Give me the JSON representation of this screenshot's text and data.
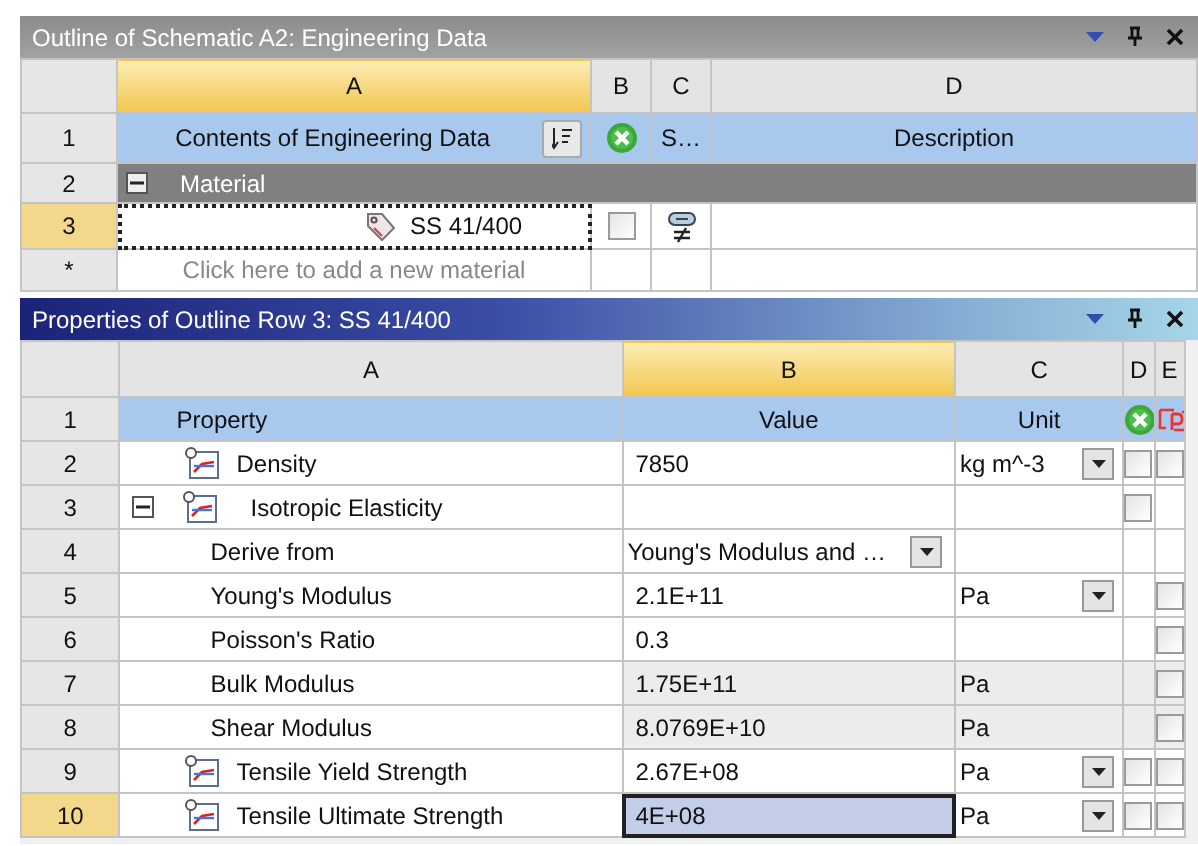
{
  "outline": {
    "title": "Outline of Schematic A2: Engineering Data",
    "columns": [
      {
        "label": "A",
        "selected": true
      },
      {
        "label": "B",
        "selected": false
      },
      {
        "label": "C",
        "selected": false
      },
      {
        "label": "D",
        "selected": false
      }
    ],
    "rows": [
      {
        "number": "1",
        "kind": "header",
        "content": "Contents of Engineering Data",
        "column_c": "S…",
        "description": "Description"
      },
      {
        "number": "2",
        "kind": "group",
        "label": "Material",
        "expanded": true,
        "children": [
          {
            "number": "3",
            "kind": "material",
            "name": "SS 41/400",
            "selected": true,
            "checked": false
          }
        ]
      },
      {
        "number": "*",
        "kind": "new",
        "placeholder": "Click here to add a new material"
      }
    ]
  },
  "properties": {
    "title": "Properties of Outline Row 3: SS 41/400",
    "columns": [
      {
        "label": "A",
        "selected": false
      },
      {
        "label": "B",
        "selected": true
      },
      {
        "label": "C",
        "selected": false
      },
      {
        "label": "D",
        "selected": false
      },
      {
        "label": "E",
        "selected": false
      }
    ],
    "rows": [
      {
        "number": "1",
        "kind": "header",
        "property": "Property",
        "value": "Value",
        "unit": "Unit"
      },
      {
        "number": "2",
        "kind": "chart",
        "name": "Density",
        "value": "7850",
        "unit": "kg m^-3",
        "unit_dropdown": true,
        "d_checked": false,
        "e_checked": false,
        "selected": false
      },
      {
        "number": "3",
        "kind": "group",
        "name": "Isotropic Elasticity",
        "expanded": true,
        "d_checked": false,
        "selected": false,
        "children": [
          {
            "number": "4",
            "kind": "plain",
            "name": "Derive from",
            "value": "Young's Modulus and …",
            "value_dropdown": true,
            "selected": false
          },
          {
            "number": "5",
            "kind": "plain",
            "name": "Young's Modulus",
            "value": "2.1E+11",
            "unit": "Pa",
            "unit_dropdown": true,
            "e_checked": false,
            "selected": false
          },
          {
            "number": "6",
            "kind": "plain",
            "name": "Poisson's Ratio",
            "value": "0.3",
            "e_checked": false,
            "selected": false
          },
          {
            "number": "7",
            "kind": "plain",
            "name": "Bulk Modulus",
            "value": "1.75E+11",
            "unit": "Pa",
            "readonly": true,
            "e_checked": false,
            "selected": false
          },
          {
            "number": "8",
            "kind": "plain",
            "name": "Shear Modulus",
            "value": "8.0769E+10",
            "unit": "Pa",
            "readonly": true,
            "e_checked": false,
            "selected": false
          }
        ]
      },
      {
        "number": "9",
        "kind": "chart",
        "name": "Tensile Yield Strength",
        "value": "2.67E+08",
        "unit": "Pa",
        "unit_dropdown": true,
        "d_checked": false,
        "e_checked": false,
        "selected": false
      },
      {
        "number": "10",
        "kind": "chart",
        "name": "Tensile Ultimate Strength",
        "value": "4E+08",
        "unit": "Pa",
        "unit_dropdown": true,
        "d_checked": false,
        "e_checked": false,
        "selected": true
      }
    ]
  }
}
